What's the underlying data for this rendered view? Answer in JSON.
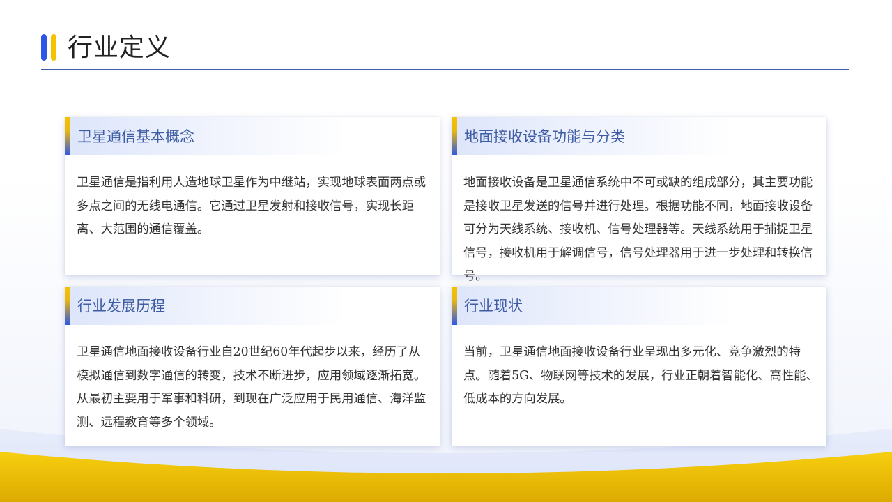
{
  "slide": {
    "title": "行业定义"
  },
  "cards": [
    {
      "title": "卫星通信基本概念",
      "body": "卫星通信是指利用人造地球卫星作为中继站，实现地球表面两点或多点之间的无线电通信。它通过卫星发射和接收信号，实现长距离、大范围的通信覆盖。"
    },
    {
      "title": "地面接收设备功能与分类",
      "body": "地面接收设备是卫星通信系统中不可或缺的组成部分，其主要功能是接收卫星发送的信号并进行处理。根据功能不同，地面接收设备可分为天线系统、接收机、信号处理器等。天线系统用于捕捉卫星信号，接收机用于解调信号，信号处理器用于进一步处理和转换信号。"
    },
    {
      "title": "行业发展历程",
      "body": "卫星通信地面接收设备行业自20世纪60年代起步以来，经历了从模拟通信到数字通信的转变，技术不断进步，应用领域逐渐拓宽。从最初主要用于军事和科研，到现在广泛应用于民用通信、海洋监测、远程教育等多个领域。"
    },
    {
      "title": "行业现状",
      "body": "当前，卫星通信地面接收设备行业呈现出多元化、竞争激烈的特点。随着5G、物联网等技术的发展，行业正朝着智能化、高性能、低成本的方向发展。"
    }
  ],
  "colors": {
    "accent_blue": "#2e56e6",
    "accent_yellow": "#f5c200",
    "title_blue": "#3f5da4"
  }
}
